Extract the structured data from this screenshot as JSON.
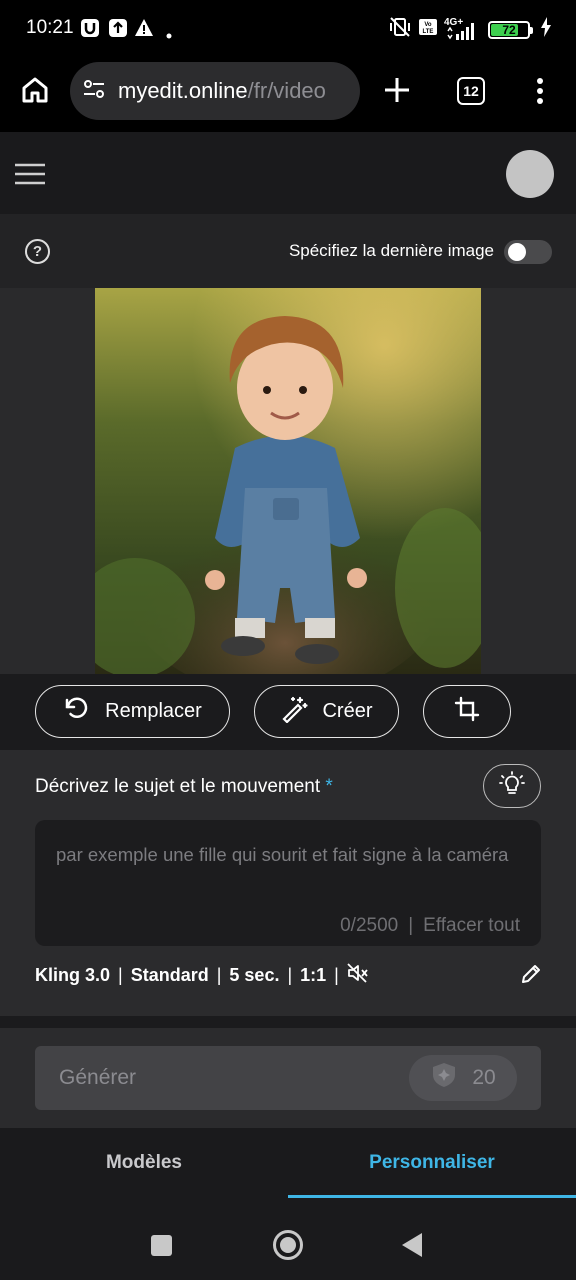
{
  "status_bar": {
    "time": "10:21",
    "battery": "72",
    "battery_level": 0.72,
    "network": "4G+",
    "icons": [
      "u-app-icon",
      "upload-icon",
      "warning-icon",
      "dot-icon",
      "vibrate-off-icon",
      "volte-icon",
      "signal-icon",
      "battery-icon",
      "charging-icon"
    ]
  },
  "browser": {
    "url_domain": "myedit.online",
    "url_path": "/fr/video",
    "tab_count": "12",
    "icons": [
      "home-icon",
      "site-settings-icon",
      "new-tab-icon",
      "tabs-icon",
      "more-menu-icon"
    ]
  },
  "header": {
    "icons": [
      "hamburger-menu-icon",
      "avatar"
    ]
  },
  "toggle_row": {
    "help_symbol": "?",
    "label": "Spécifiez la dernière image",
    "toggle_on": false
  },
  "image": {
    "icons": [
      "uploaded-photo"
    ]
  },
  "actions": {
    "replace_label": "Remplacer",
    "create_label": "Créer",
    "icons": [
      "replace-icon",
      "magic-wand-icon",
      "crop-icon"
    ]
  },
  "prompt": {
    "label": "Décrivez le sujet et le mouvement",
    "required_mark": "*",
    "placeholder": "par exemple une fille qui sourit et fait signe à la caméra",
    "counter": "0/2500",
    "counter_sep": "|",
    "clear_label": "Effacer tout",
    "icons": [
      "lightbulb-icon"
    ]
  },
  "settings": {
    "model": "Kling 3.0",
    "quality": "Standard",
    "duration": "5 sec.",
    "ratio": "1:1",
    "sep": "|",
    "icons": [
      "mute-icon",
      "pencil-icon"
    ]
  },
  "generate": {
    "label": "Générer",
    "credits": "20",
    "icons": [
      "credit-icon"
    ]
  },
  "tabs": {
    "models_label": "Modèles",
    "custom_label": "Personnaliser",
    "active": "Personnaliser"
  },
  "colors": {
    "accent": "#3fb6e6",
    "battery": "#3ecf4f",
    "panel": "#2b2b2d",
    "header": "#1a1a1c"
  },
  "nav": {
    "icons": [
      "recent-apps-icon",
      "home-circle-icon",
      "back-icon"
    ]
  }
}
